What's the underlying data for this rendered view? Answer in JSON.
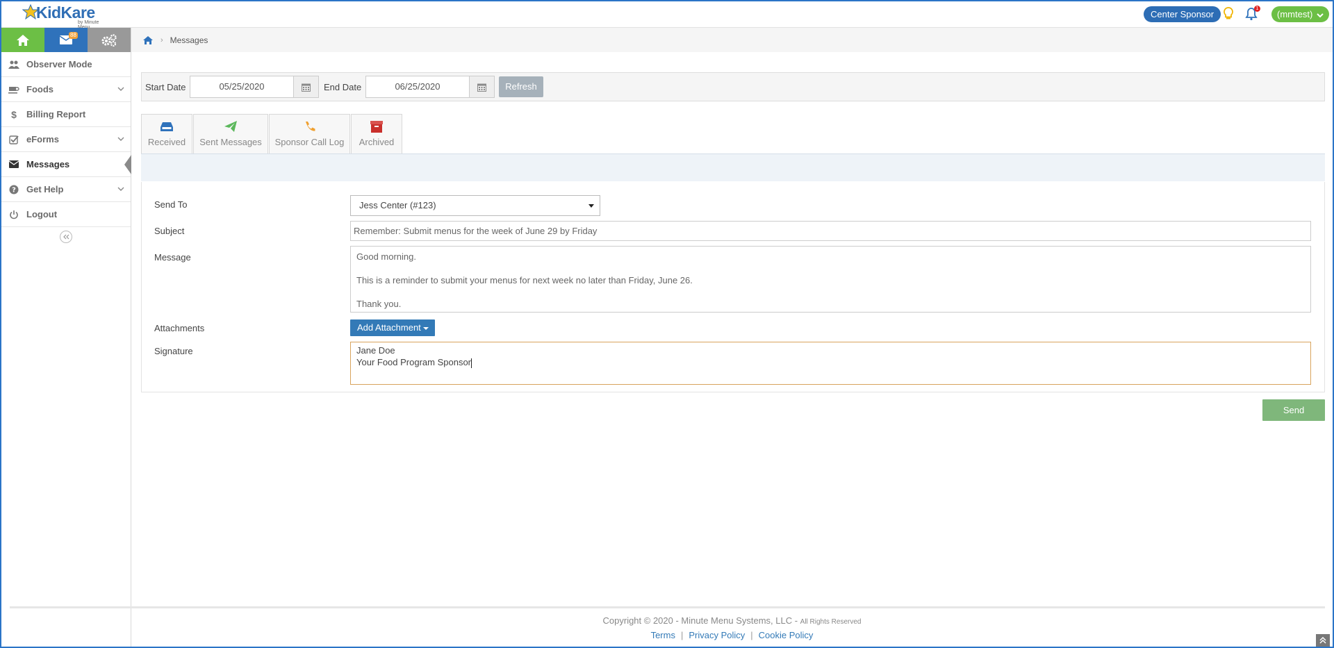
{
  "header": {
    "logo_text": "KidKare",
    "logo_sub": "by Minute Menu",
    "sponsor_label": "Center Sponsor",
    "user_label": "(mmtest)",
    "notification_count": "1"
  },
  "sidebar": {
    "mail_badge": "88",
    "items": [
      {
        "label": "Observer Mode",
        "icon": "users-icon"
      },
      {
        "label": "Foods",
        "icon": "coffee-icon"
      },
      {
        "label": "Billing Report",
        "icon": "dollar-icon"
      },
      {
        "label": "eForms",
        "icon": "checkbox-icon"
      },
      {
        "label": "Messages",
        "icon": "envelope-icon"
      },
      {
        "label": "Get Help",
        "icon": "question-icon"
      },
      {
        "label": "Logout",
        "icon": "power-icon"
      }
    ]
  },
  "breadcrumb": {
    "current": "Messages"
  },
  "filter": {
    "start_label": "Start Date",
    "start_value": "05/25/2020",
    "end_label": "End Date",
    "end_value": "06/25/2020",
    "refresh_label": "Refresh"
  },
  "tabs": [
    {
      "label": "Received"
    },
    {
      "label": "Sent Messages"
    },
    {
      "label": "Sponsor Call Log"
    },
    {
      "label": "Archived"
    }
  ],
  "form": {
    "send_to_label": "Send To",
    "send_to_value": "Jess Center (#123)",
    "subject_label": "Subject",
    "subject_value": "Remember: Submit menus for the week of June 29 by Friday",
    "message_label": "Message",
    "message_lines": [
      "Good morning.",
      "This is a reminder to submit your menus for next week no later than Friday, June 26.",
      "Thank you."
    ],
    "attachments_label": "Attachments",
    "add_attachment_label": "Add Attachment",
    "signature_label": "Signature",
    "signature_lines": [
      "Jane Doe",
      "Your Food Program Sponsor"
    ],
    "send_label": "Send"
  },
  "footer": {
    "copyright": "Copyright © 2020 - Minute Menu Systems, LLC - ",
    "rights": "All Rights Reserved",
    "links": [
      "Terms",
      "Privacy Policy",
      "Cookie Policy"
    ]
  },
  "colors": {
    "brand_blue": "#2f72bb",
    "brand_green": "#6cbf45",
    "send_green": "#7fb77b",
    "signature_border": "#d8a35c"
  }
}
